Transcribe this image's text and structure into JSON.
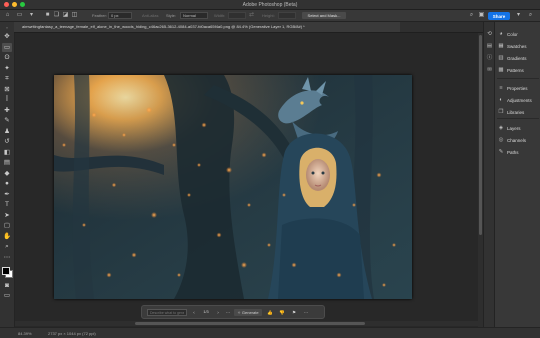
{
  "window": {
    "title": "Adobe Photoshop (Beta)",
    "traffic_colors": [
      "#ff5f57",
      "#febc2e",
      "#28c840"
    ]
  },
  "options_bar": {
    "feather_label": "Feather:",
    "feather_value": "0 px",
    "antialias_label": "Anti-alias",
    "style_label": "Style:",
    "style_value": "Normal",
    "width_label": "Width:",
    "height_label": "Height:",
    "select_mask_label": "Select and Mask...",
    "share_label": "Share",
    "accent": "#1473e6"
  },
  "document_tab": {
    "label": "aimwritingfantasy_a_teenage_female_elf_alone_in_the_woods_hiding_c46ac265-3612-4084-a037-fd0aca65f4a0.png @ 84.4% (Generative Layer 1, RGB/8#) *"
  },
  "tools": [
    {
      "icon": "move-icon",
      "glyph": "✥"
    },
    {
      "icon": "marquee-icon",
      "glyph": "▭"
    },
    {
      "icon": "lasso-icon",
      "glyph": "ʘ"
    },
    {
      "icon": "magic-wand-icon",
      "glyph": "✦"
    },
    {
      "icon": "crop-icon",
      "glyph": "⌗"
    },
    {
      "icon": "frame-icon",
      "glyph": "⊠"
    },
    {
      "icon": "eyedropper-icon",
      "glyph": "ꟾ"
    },
    {
      "icon": "healing-brush-icon",
      "glyph": "✚"
    },
    {
      "icon": "brush-icon",
      "glyph": "✎"
    },
    {
      "icon": "stamp-icon",
      "glyph": "♟"
    },
    {
      "icon": "history-brush-icon",
      "glyph": "↺"
    },
    {
      "icon": "eraser-icon",
      "glyph": "◧"
    },
    {
      "icon": "gradient-icon",
      "glyph": "▤"
    },
    {
      "icon": "blur-icon",
      "glyph": "◆"
    },
    {
      "icon": "dodge-icon",
      "glyph": "●"
    },
    {
      "icon": "pen-icon",
      "glyph": "✒"
    },
    {
      "icon": "type-icon",
      "glyph": "T"
    },
    {
      "icon": "path-select-icon",
      "glyph": "➤"
    },
    {
      "icon": "rectangle-icon",
      "glyph": "▢"
    },
    {
      "icon": "hand-icon",
      "glyph": "✋"
    },
    {
      "icon": "zoom-icon",
      "glyph": "⌕"
    },
    {
      "icon": "more-tools-icon",
      "glyph": "⋯"
    }
  ],
  "context_bar": {
    "prompt_placeholder": "Describe what to generate",
    "variation_count": "1/3",
    "generate_label": "Generate"
  },
  "status_bar": {
    "zoom": "84.39%",
    "doc_info": "2737 px × 1044 px (72 ppi)"
  },
  "panels": [
    {
      "icon": "color-icon",
      "glyph": "◕",
      "label": "Color"
    },
    {
      "icon": "swatches-icon",
      "glyph": "▦",
      "label": "Swatches"
    },
    {
      "icon": "gradients-icon",
      "glyph": "▥",
      "label": "Gradients"
    },
    {
      "icon": "patterns-icon",
      "glyph": "▩",
      "label": "Patterns"
    },
    {
      "icon": "properties-icon",
      "glyph": "≡",
      "label": "Properties"
    },
    {
      "icon": "adjustments-icon",
      "glyph": "◐",
      "label": "Adjustments"
    },
    {
      "icon": "libraries-icon",
      "glyph": "❐",
      "label": "Libraries"
    },
    {
      "icon": "layers-icon",
      "glyph": "◈",
      "label": "Layers"
    },
    {
      "icon": "channels-icon",
      "glyph": "◎",
      "label": "Channels"
    },
    {
      "icon": "paths-icon",
      "glyph": "✎",
      "label": "Paths"
    }
  ]
}
